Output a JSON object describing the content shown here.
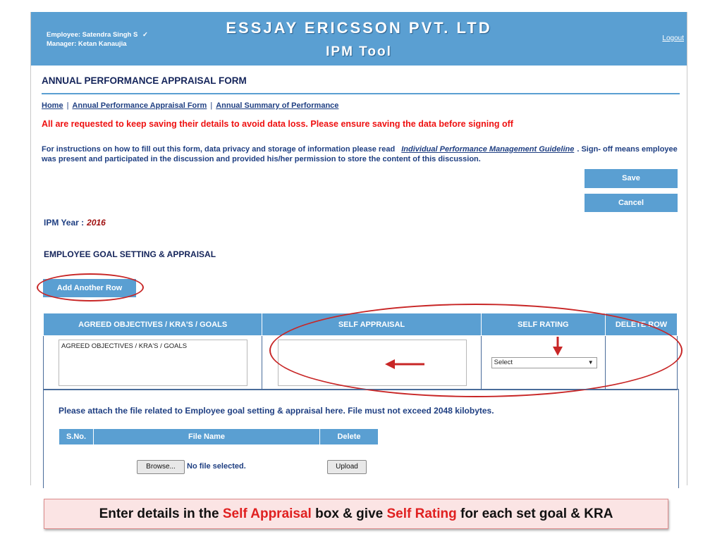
{
  "header": {
    "employee": "Employee: Satendra Singh S",
    "check_glyph": "✓",
    "manager": "Manager: Ketan Kanaujia",
    "company": "ESSJAY ERICSSON PVT. LTD",
    "tool": "IPM Tool",
    "logout": "Logout",
    "color": "#5a9fd2"
  },
  "form_title": "ANNUAL PERFORMANCE APPRAISAL FORM",
  "breadcrumbs": [
    "Home",
    "Annual Performance Appraisal Form",
    "Annual Summary of Performance"
  ],
  "warning": "All are requested to keep saving their details to avoid data loss. Please ensure saving the data before signing off",
  "instructions": {
    "before": "For instructions on how to fill out this form, data privacy and storage of information please read",
    "link": "Individual Performance Management Guideline",
    "after": ". Sign- off means employee was present and participated in the discussion and provided his/her permission to store the content of this discussion."
  },
  "buttons": {
    "save": "Save",
    "cancel": "Cancel",
    "add_row": "Add Another Row"
  },
  "ipm_year": {
    "label": "IPM Year :",
    "value": "2016"
  },
  "section_title": "EMPLOYEE GOAL SETTING & APPRAISAL",
  "goals_table": {
    "headers": [
      "AGREED OBJECTIVES / KRA'S / GOALS",
      "SELF APPRAISAL",
      "SELF RATING",
      "DELETE ROW"
    ],
    "row": {
      "objectives_value": "AGREED OBJECTIVES / KRA'S / GOALS",
      "self_appraisal_value": "",
      "rating_selected": "Select"
    }
  },
  "attachments": {
    "message": "Please attach the file related to Employee goal setting & appraisal here. File must not exceed 2048 kilobytes.",
    "headers": [
      "S.No.",
      "File Name",
      "Delete"
    ],
    "browse": "Browse...",
    "no_file": "No file selected.",
    "upload": "Upload"
  },
  "caption": {
    "part1": "Enter details in the ",
    "hl1": "Self Appraisal",
    "part2": " box & give ",
    "hl2": "Self Rating",
    "part3": " for each set goal & KRA"
  },
  "annotation_color": "#c82626"
}
